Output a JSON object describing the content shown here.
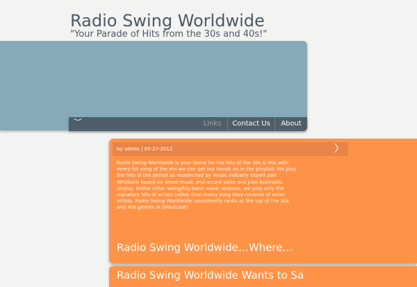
{
  "site": {
    "title": "Radio Swing Worldwide",
    "tagline": "\"Your Parade of Hits from the 30s and 40s!\""
  },
  "nav": {
    "toggle_icon": "︶",
    "items": [
      {
        "label": "Links",
        "active": true
      },
      {
        "label": "Contact Us",
        "active": false
      },
      {
        "label": "About",
        "active": false
      }
    ]
  },
  "posts": [
    {
      "meta": "by admin | 05-27-2012",
      "arrow_icon": "〉",
      "body": "Radio Swing Worldwide is your home for the hits of the 30s & 40s with every hit song of the era we can get our hands on in the playlist!  We play the hits of the period as researched by music industry expert Joel Whitburn based on sheet music and record sales and juke box/radio airplay.  Unlike other swing/big band music stations, we play only the signature hits of artists rather than every song they covered of other artists.  Radio Swing Worldwide consistently ranks at the top of the 30s and 40s genres in Shoutcast!",
      "title": "Radio Swing Worldwide…Where…"
    },
    {
      "title": "Radio Swing Worldwide Wants to Sa"
    }
  ],
  "colors": {
    "banner": "#87aab9",
    "nav": "#4f5e68",
    "post": "#fe9347",
    "post_meta_bar": "#e88447"
  }
}
